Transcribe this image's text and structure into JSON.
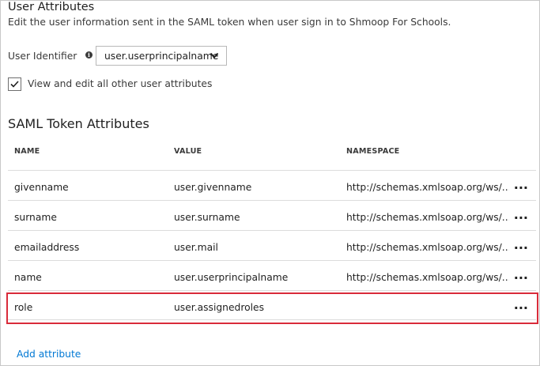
{
  "user_attributes": {
    "title": "User Attributes",
    "description": "Edit the user information sent in the SAML token when user sign in to Shmoop For Schools.",
    "user_identifier_label": "User Identifier",
    "user_identifier_value": "user.userprincipalname",
    "checkbox_checked": true,
    "checkbox_label": "View and edit all other user attributes"
  },
  "saml": {
    "title": "SAML Token Attributes",
    "columns": {
      "name": "NAME",
      "value": "VALUE",
      "namespace": "NAMESPACE"
    },
    "rows": [
      {
        "name": "givenname",
        "value": "user.givenname",
        "namespace": "http://schemas.xmlsoap.org/ws/...",
        "more": "..."
      },
      {
        "name": "surname",
        "value": "user.surname",
        "namespace": "http://schemas.xmlsoap.org/ws/...",
        "more": "..."
      },
      {
        "name": "emailaddress",
        "value": "user.mail",
        "namespace": "http://schemas.xmlsoap.org/ws/...",
        "more": "..."
      },
      {
        "name": "name",
        "value": "user.userprincipalname",
        "namespace": "http://schemas.xmlsoap.org/ws/...",
        "more": "..."
      },
      {
        "name": "role",
        "value": "user.assignedroles",
        "namespace": "",
        "more": "..."
      }
    ],
    "add_attribute_label": "Add attribute"
  },
  "colors": {
    "highlight": "#d92b3a",
    "link": "#0078d4"
  },
  "icons": {
    "info": "info-icon",
    "dropdown": "chevron-down-icon",
    "check": "checkmark-icon",
    "more": "more-options-icon"
  }
}
